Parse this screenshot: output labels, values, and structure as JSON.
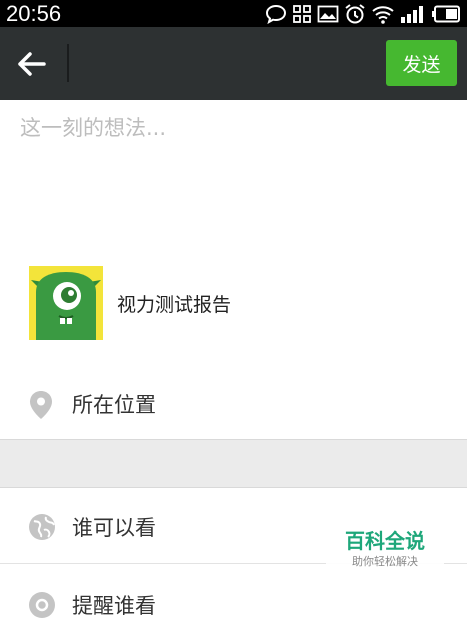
{
  "status_bar": {
    "time": "20:56",
    "icons": [
      "chat-bubble-icon",
      "apps-grid-icon",
      "image-icon",
      "alarm-icon",
      "wifi-icon",
      "signal-icon",
      "battery-icon"
    ]
  },
  "toolbar": {
    "back_icon": "arrow-left-icon",
    "send_label": "发送",
    "send_color": "#46b830",
    "background": "#2d3132"
  },
  "composer": {
    "placeholder": "这一刻的想法..."
  },
  "shared_item": {
    "thumbnail_icon": "green-one-eyed-monster",
    "title": "视力测试报告"
  },
  "options": {
    "location": {
      "icon": "location-pin-icon",
      "label": "所在位置"
    },
    "visibility": {
      "icon": "globe-icon",
      "label": "谁可以看"
    },
    "remind": {
      "icon": "at-icon",
      "label": "提醒谁看"
    }
  },
  "watermark": {
    "title": "百科全说",
    "subtitle": "助你轻松解决"
  }
}
